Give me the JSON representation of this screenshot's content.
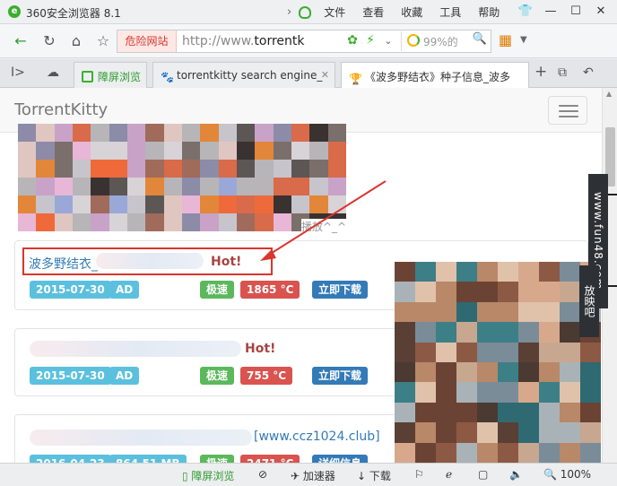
{
  "window": {
    "app_title": "360安全浏览器 8.1",
    "menu": [
      "文件",
      "查看",
      "收藏",
      "工具",
      "帮助"
    ],
    "controls": [
      "shirt-icon",
      "minimize-icon",
      "maximize-icon",
      "close-icon"
    ]
  },
  "addressbar": {
    "danger_label": "危险网站",
    "url_prefix": "http://www.",
    "url_host": "torrentk",
    "search_placeholder": "99%的"
  },
  "tabs": [
    {
      "label": "障屏浏览"
    },
    {
      "label": "torrentkitty search engine_"
    },
    {
      "label": "《波多野结衣》种子信息_波多"
    }
  ],
  "page": {
    "brand": "TorrentKitty",
    "overlay_text": "播放^_^",
    "results": [
      {
        "title": "波多野结衣_",
        "hot": "Hot!",
        "date": "2015-07-30",
        "size": "AD",
        "speed": "极速",
        "temp": "1865 °C",
        "download": "立即下载"
      },
      {
        "title": "",
        "hot": "Hot!",
        "date": "2015-07-30",
        "size": "AD",
        "speed": "极速",
        "temp": "755 °C",
        "download": "立即下载"
      },
      {
        "title": "[www.ccz1024.club]",
        "hot": "",
        "date": "2016-04-23",
        "size": "864.51 MB",
        "speed": "极速",
        "temp": "2471 °C",
        "download": "详细信息"
      }
    ]
  },
  "watermark": {
    "main": "www.fun48.com",
    "sub": "放映吧"
  },
  "statusbar": {
    "split_view": "障屏浏览",
    "accelerator": "加速器",
    "download": "下载",
    "zoom": "100%"
  },
  "colors": {
    "danger": "#d6372b",
    "info": "#5bc0de",
    "success": "#5cb85c",
    "danger_badge": "#d9534f",
    "primary": "#337ab7",
    "highlight_box": "#d9362e"
  }
}
